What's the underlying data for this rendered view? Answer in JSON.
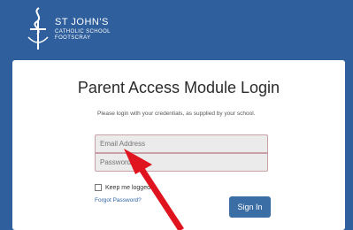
{
  "header": {
    "logo_icon": "school-crest-icon",
    "school_name": "ST JOHN'S",
    "school_sub_1": "CATHOLIC SCHOOL",
    "school_sub_2": "FOOTSCRAY"
  },
  "login": {
    "title": "Parent Access Module Login",
    "intro": "Please login with your credentials, as supplied by your school.",
    "email_placeholder": "Email Address",
    "password_placeholder": "Password",
    "remember_label": "Keep me logged in",
    "forgot_label": "Forgot Password?",
    "signin_label": "Sign In"
  },
  "colors": {
    "background": "#2f5f9c",
    "card": "#ffffff",
    "signin_button": "#3a6ea5",
    "arrow": "#e0141e"
  },
  "annotation": {
    "icon": "red-arrow-icon",
    "points_to": "email-address-field"
  }
}
